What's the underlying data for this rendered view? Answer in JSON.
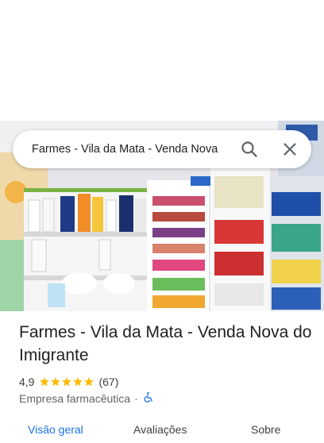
{
  "place": {
    "search_query": "Farmes - Vila da Mata - Venda Nova",
    "title": "Farmes - Vila da Mata - Venda Nova do Imigrante",
    "rating": "4,9",
    "stars": 5,
    "review_count": "(67)",
    "category": "Empresa farmacêutica",
    "separator": "·"
  },
  "tabs": [
    {
      "label": "Visão geral"
    },
    {
      "label": "Avaliações"
    },
    {
      "label": "Sobre"
    }
  ],
  "icons": {
    "search": "search-icon",
    "close": "close-icon",
    "star": "star-icon",
    "accessibility": "wheelchair-icon"
  },
  "colors": {
    "star": "#fbbc04",
    "accent": "#1a73e8",
    "text": "#202124"
  }
}
